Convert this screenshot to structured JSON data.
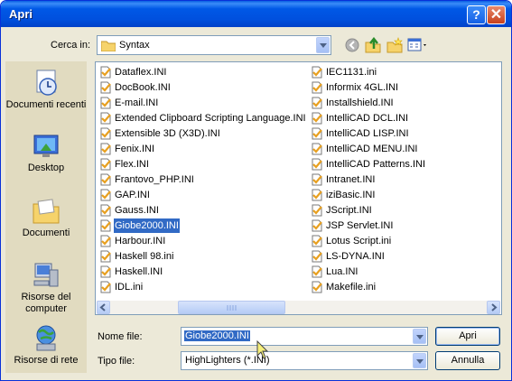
{
  "window": {
    "title": "Apri"
  },
  "titlebar": {
    "help_label": "?",
    "close_label": "✕"
  },
  "lookin": {
    "label": "Cerca in:",
    "value": "Syntax"
  },
  "places": [
    {
      "label": "Documenti recenti"
    },
    {
      "label": "Desktop"
    },
    {
      "label": "Documenti"
    },
    {
      "label": "Risorse del computer"
    },
    {
      "label": "Risorse di rete"
    }
  ],
  "files_col1": [
    "Dataflex.INI",
    "DocBook.INI",
    "E-mail.INI",
    "Extended Clipboard Scripting Language.INI",
    "Extensible 3D (X3D).INI",
    "Fenix.INI",
    "Flex.INI",
    "Frantovo_PHP.INI",
    "GAP.INI",
    "Gauss.INI",
    "Giobe2000.INI",
    "Harbour.INI",
    "Haskell 98.ini",
    "Haskell.INI",
    "IDL.ini"
  ],
  "files_col2": [
    "IEC1131.ini",
    "Informix 4GL.INI",
    "Installshield.INI",
    "IntelliCAD DCL.INI",
    "IntelliCAD LISP.INI",
    "IntelliCAD MENU.INI",
    "IntelliCAD Patterns.INI",
    "Intranet.INI",
    "iziBasic.INI",
    "JScript.INI",
    "JSP Servlet.INI",
    "Lotus Script.ini",
    "LS-DYNA.INI",
    "Lua.INI",
    "Makefile.ini"
  ],
  "selected_file": "Giobe2000.INI",
  "filename": {
    "label": "Nome file:",
    "value": "Giobe2000.INI"
  },
  "filetype": {
    "label": "Tipo file:",
    "value": "HighLighters (*.INI)"
  },
  "buttons": {
    "open": "Apri",
    "cancel": "Annulla"
  },
  "colors": {
    "selection": "#316ac5",
    "titlebar": "#0054e3"
  }
}
